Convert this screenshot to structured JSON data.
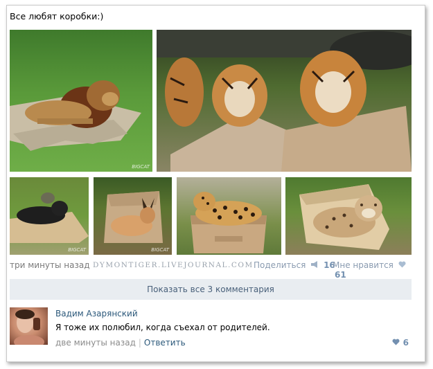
{
  "post": {
    "text": "Все любят коробки:)",
    "photos": [
      {
        "name": "lion-photo",
        "watermark": "BIGCAT"
      },
      {
        "name": "tigers-photo"
      },
      {
        "name": "panther-photo",
        "watermark": "BIGCAT"
      },
      {
        "name": "caracal-photo",
        "watermark": "BIGCAT"
      },
      {
        "name": "jaguar-photo"
      },
      {
        "name": "bobcat-photo"
      }
    ],
    "time": "три минуты назад",
    "site_watermark": "DYMONTIGER.LIVEJOURNAL.COM",
    "share_label": "Поделиться",
    "share_count": "16",
    "like_label": "Мне нравится",
    "like_count": "61",
    "share_icon": "megaphone-icon",
    "like_icon": "heart-icon"
  },
  "comments": {
    "show_all_label": "Показать все 3 комментария",
    "items": [
      {
        "author": "Вадим Азарянский",
        "text": "Я тоже их полюбил, когда съехал от родителей.",
        "time": "две минуты назад",
        "separator": "|",
        "reply_label": "Ответить",
        "likes": "6"
      }
    ]
  },
  "colors": {
    "link": "#2b587a",
    "accent": "#7390b0",
    "button_bg": "#e9edf1"
  }
}
